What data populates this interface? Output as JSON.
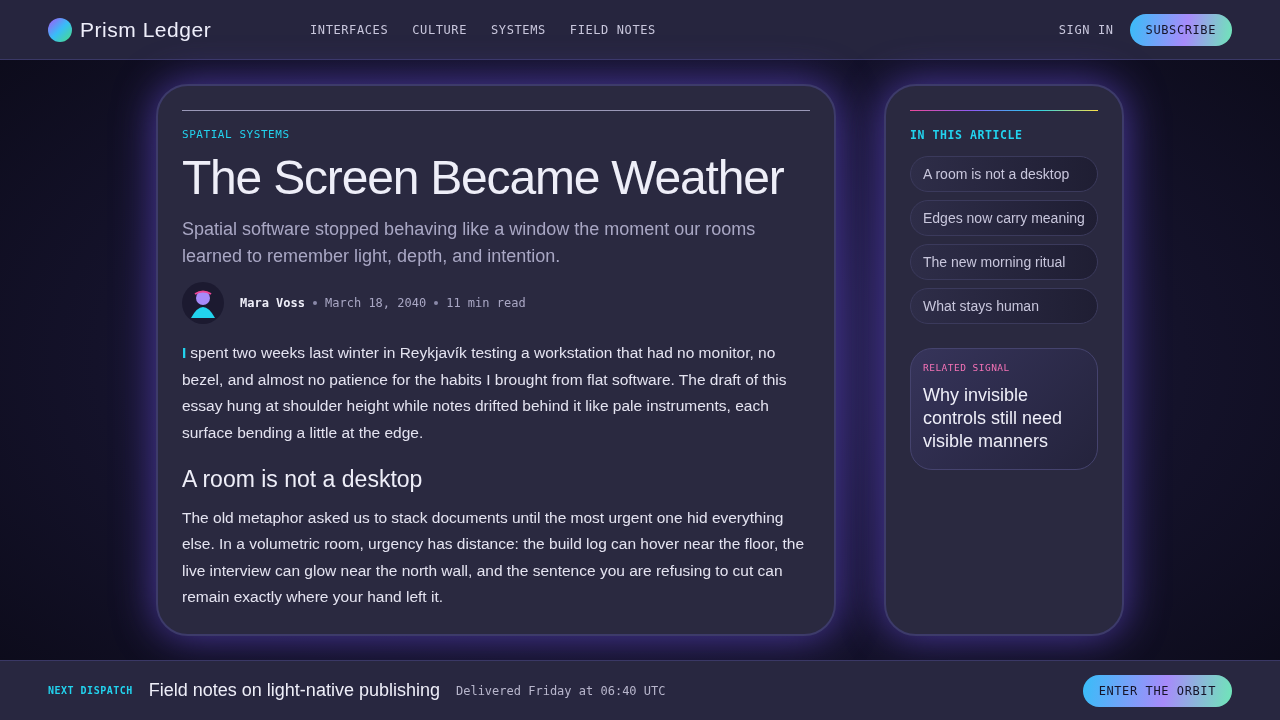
{
  "brand": {
    "name": "Prism Ledger"
  },
  "nav": [
    {
      "label": "INTERFACES"
    },
    {
      "label": "CULTURE"
    },
    {
      "label": "SYSTEMS"
    },
    {
      "label": "FIELD NOTES"
    }
  ],
  "actions": {
    "sign_in": "SIGN IN",
    "subscribe": "SUBSCRIBE"
  },
  "article": {
    "kicker": "SPATIAL SYSTEMS",
    "title": "The Screen Became Weather",
    "dek": "Spatial software stopped behaving like a window the moment our rooms learned to remember light, depth, and intention.",
    "author": "Mara Voss",
    "date": "March 18, 2040",
    "read_time": "11 min read",
    "lead": "I",
    "intro": "spent two weeks last winter in Reykjavík testing a workstation that had no monitor, no bezel, and almost no patience for the habits I brought from flat software. The draft of this essay hung at shoulder height while notes drifted behind it like pale instruments, each surface bending a little at the edge.",
    "heading": "A room is not a desktop",
    "body": "The old metaphor asked us to stack documents until the most urgent one hid everything else. In a volumetric room, urgency has distance: the build log can hover near the floor, the live interview can glow near the north wall, and the sentence you are refusing to cut can remain exactly where your hand left it."
  },
  "toc": {
    "title": "IN THIS ARTICLE",
    "items": [
      {
        "label": "A room is not a desktop"
      },
      {
        "label": "Edges now carry meaning"
      },
      {
        "label": "The new morning ritual"
      },
      {
        "label": "What stays human"
      }
    ]
  },
  "related": {
    "label": "RELATED SIGNAL",
    "title": "Why invisible controls still need visible manners"
  },
  "footer": {
    "label": "NEXT DISPATCH",
    "title": "Field notes on light-native publishing",
    "meta": "Delivered Friday at 06:40 UTC",
    "cta": "ENTER THE ORBIT"
  }
}
